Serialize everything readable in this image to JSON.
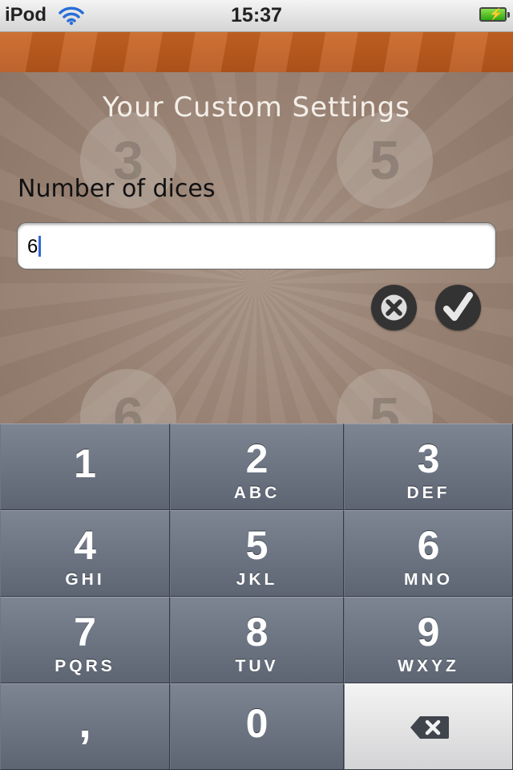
{
  "status_bar": {
    "carrier": "iPod",
    "time": "15:37"
  },
  "background_numbers": [
    "3",
    "5",
    "6",
    "5"
  ],
  "settings": {
    "title": "Your Custom Settings",
    "field_label": "Number of dices",
    "field_value": "6"
  },
  "keypad": {
    "keys": [
      {
        "num": "1",
        "letters": ""
      },
      {
        "num": "2",
        "letters": "ABC"
      },
      {
        "num": "3",
        "letters": "DEF"
      },
      {
        "num": "4",
        "letters": "GHI"
      },
      {
        "num": "5",
        "letters": "JKL"
      },
      {
        "num": "6",
        "letters": "MNO"
      },
      {
        "num": "7",
        "letters": "PQRS"
      },
      {
        "num": "8",
        "letters": "TUV"
      },
      {
        "num": "9",
        "letters": "WXYZ"
      },
      {
        "num": ","
      },
      {
        "num": "0"
      }
    ]
  },
  "colors": {
    "banner": "#c0601f",
    "panel": "#9b8475",
    "keypad_key": "#6b7382",
    "caret": "#3467d6"
  }
}
